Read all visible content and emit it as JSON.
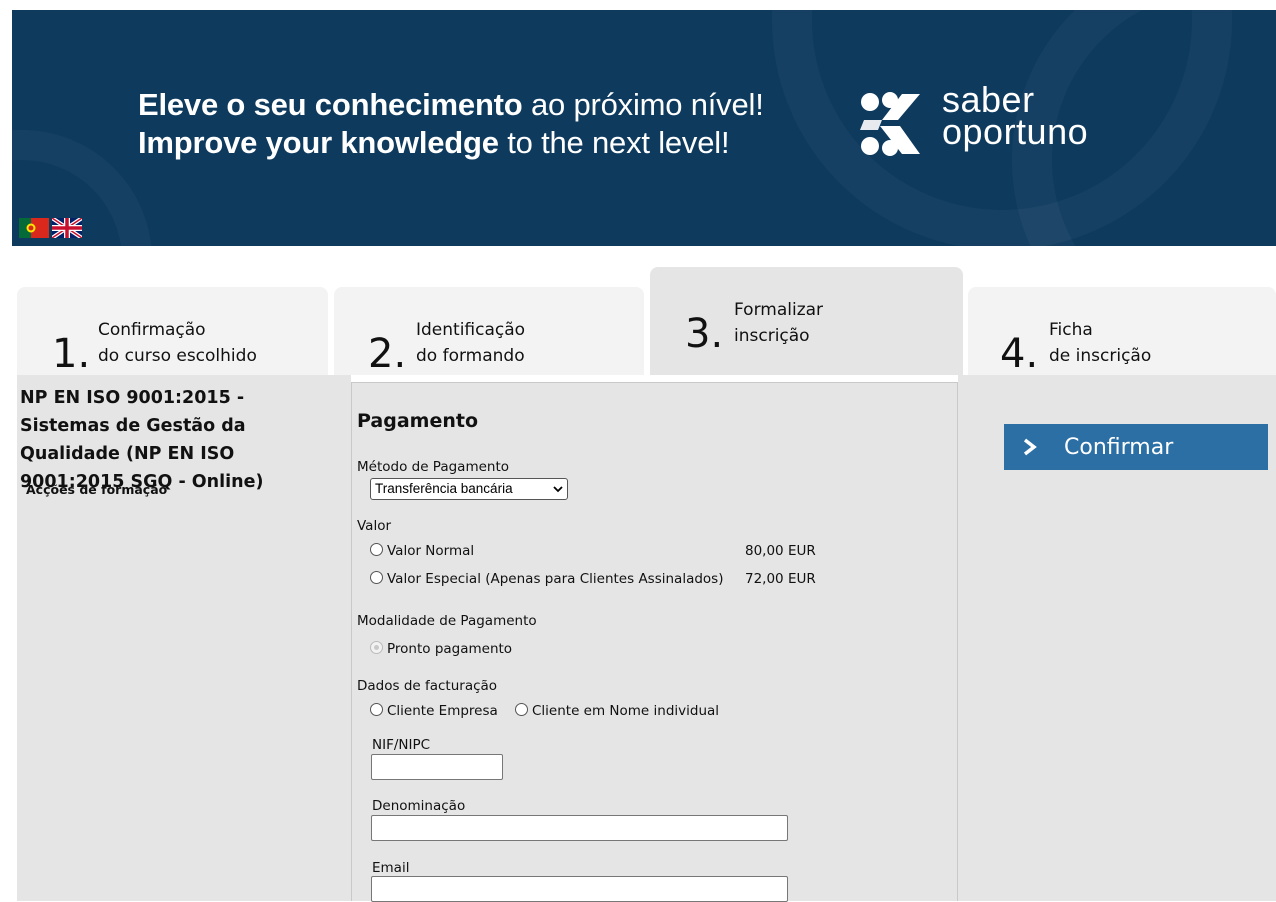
{
  "banner": {
    "line1_bold": "Eleve o seu conhecimento",
    "line1_rest": " ao próximo nível!",
    "line2_bold": "Improve your knowledge",
    "line2_rest": " to the next level!",
    "logo_line1": "saber",
    "logo_line2": "oportuno",
    "background_color": "#0e3a5e"
  },
  "languages": [
    {
      "name": "portuguese-flag-icon"
    },
    {
      "name": "uk-flag-icon"
    }
  ],
  "steps": [
    {
      "number": "1.",
      "line1": "Confirmação",
      "line2": "do curso escolhido",
      "active": false
    },
    {
      "number": "2.",
      "line1": "Identificação",
      "line2": "do formando",
      "active": false
    },
    {
      "number": "3.",
      "line1": "Formalizar",
      "line2": "inscrição",
      "active": true
    },
    {
      "number": "4.",
      "line1": "Ficha",
      "line2": "de inscrição",
      "active": false
    }
  ],
  "course": {
    "title": "NP EN ISO 9001:2015 - Sistemas de Gestão da Qualidade (NP EN ISO 9001:2015 SGQ - Online)",
    "actions_label": "Acções de formação"
  },
  "payment": {
    "title": "Pagamento",
    "method_label": "Método de Pagamento",
    "method_selected": "Transferência bancária",
    "value_label": "Valor",
    "values": [
      {
        "label": "Valor Normal",
        "amount": "80,00 EUR"
      },
      {
        "label": "Valor Especial (Apenas para Clientes Assinalados)",
        "amount": "72,00 EUR"
      }
    ],
    "modality_label": "Modalidade de Pagamento",
    "modality_option": "Pronto pagamento",
    "billing_label": "Dados de facturação",
    "billing_options": [
      "Cliente Empresa",
      "Cliente em Nome individual"
    ],
    "nif_label": "NIF/NIPC",
    "nif_value": "",
    "denominacao_label": "Denominação",
    "denominacao_value": "",
    "email_label": "Email",
    "email_value": ""
  },
  "confirm_button": "Confirmar",
  "accent_color": "#2b6fa5"
}
